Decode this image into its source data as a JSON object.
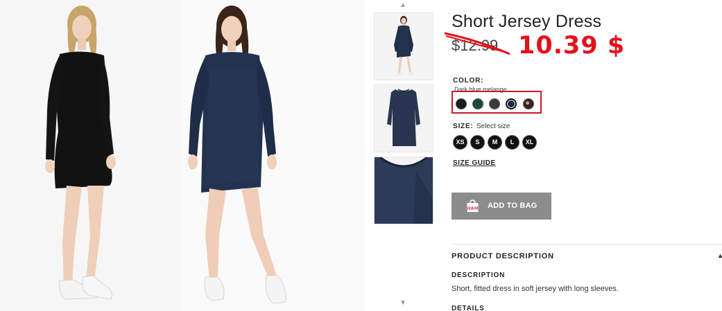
{
  "product": {
    "title": "Short Jersey Dress",
    "old_price": "$12.99",
    "new_price": "10.39 $"
  },
  "gallery": {
    "thumb_up_icon": "chevron-up-icon",
    "thumb_down_icon": "chevron-down-icon",
    "up_glyph": "▲",
    "down_glyph": "▼"
  },
  "color": {
    "label": "COLOR:",
    "selected": "Dark blue melange",
    "swatches": [
      "#1c1c1c",
      "#1f4a34",
      "#3b3b3b",
      "#1d2a44",
      "#3a2420"
    ],
    "selected_index": 3
  },
  "size": {
    "label": "SIZE:",
    "hint": "Select size",
    "options": [
      "XS",
      "S",
      "M",
      "L",
      "XL"
    ]
  },
  "size_guide": "SIZE GUIDE",
  "add_to_bag": {
    "label": "ADD TO BAG",
    "icon": "hm-bag-icon",
    "bag_text": "H&M"
  },
  "description": {
    "header": "PRODUCT DESCRIPTION",
    "collapse_glyph": "▲",
    "label": "DESCRIPTION",
    "text": "Short, fitted dress in soft jersey with long sleeves.",
    "details_label": "DETAILS"
  },
  "colors": {
    "accent_red": "#e3111a",
    "swatch_box_border": "#c81a26",
    "button_gray": "#8c8c8c"
  }
}
